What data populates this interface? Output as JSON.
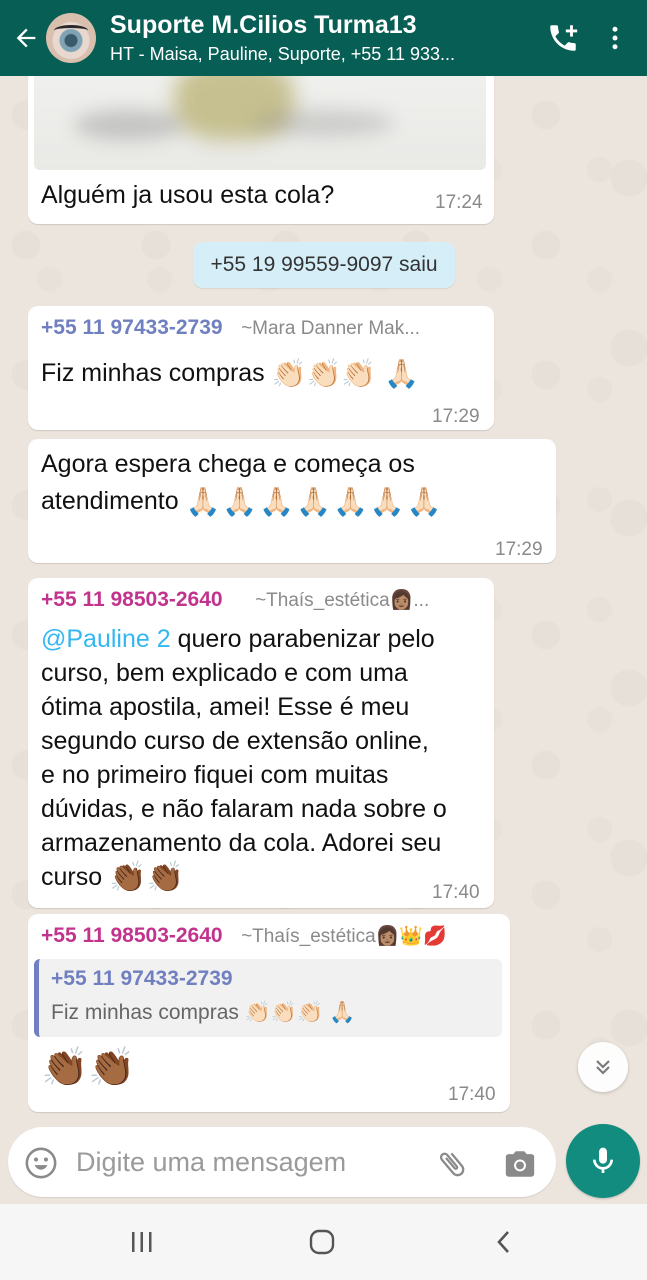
{
  "header": {
    "title": "Suporte M.Cilios Turma13",
    "subtitle": "HT - Maisa, Pauline, Suporte, +55 11 933..."
  },
  "colors": {
    "header_bg": "#075E54",
    "accent_green": "#128C7E",
    "chat_bg": "#ECE5DD",
    "system_bubble": "#D5EEF7",
    "sender_blue": "#6F7FBF",
    "sender_pink": "#C2338E",
    "mention": "#34B7F1"
  },
  "messages": [
    {
      "type": "image",
      "caption": "Alguém ja usou esta cola?",
      "time": "17:24"
    },
    {
      "type": "system",
      "text": "+55 19 99559-9097 saiu"
    },
    {
      "type": "text",
      "sender": "+55 11 97433-2739",
      "pushname": "~Mara Danner Mak...",
      "text": "Fiz minhas compras",
      "emoji": "👏🏻👏🏻👏🏻 🙏🏻",
      "time": "17:29"
    },
    {
      "type": "text",
      "text_line1": "Agora espera chega e começa os",
      "text_line2": "atendimento",
      "emoji": "🙏🏻🙏🏻🙏🏻🙏🏻🙏🏻🙏🏻🙏🏻",
      "time": "17:29"
    },
    {
      "type": "text",
      "sender": "+55 11 98503-2640",
      "pushname": "~Thaís_estética👩🏽...",
      "mention": "@Pauline 2",
      "lines": [
        " quero parabenizar pelo",
        "curso, bem explicado e com uma",
        "ótima apostila, amei! Esse é meu",
        "segundo curso de extensão online,",
        "e no primeiro fiquei com muitas",
        "dúvidas, e não falaram nada sobre o",
        "armazenamento da cola. Adorei seu",
        "curso"
      ],
      "emoji": "👏🏾👏🏾",
      "time": "17:40"
    },
    {
      "type": "reply",
      "sender": "+55 11 98503-2640",
      "pushname": "~Thaís_estética👩🏽👑💋",
      "quoted_sender": "+55 11 97433-2739",
      "quoted_text": "Fiz minhas compras",
      "quoted_emoji": "👏🏻👏🏻👏🏻 🙏🏻",
      "emoji": "👏🏾👏🏾",
      "time": "17:40"
    }
  ],
  "input": {
    "placeholder": "Digite uma mensagem"
  },
  "icons": {
    "back": "arrow-left-icon",
    "call": "add-call-icon",
    "menu": "more-vert-icon",
    "emoji": "smiley-icon",
    "attach": "paperclip-icon",
    "camera": "camera-icon",
    "mic": "mic-icon",
    "scroll": "double-chevron-down-icon"
  }
}
